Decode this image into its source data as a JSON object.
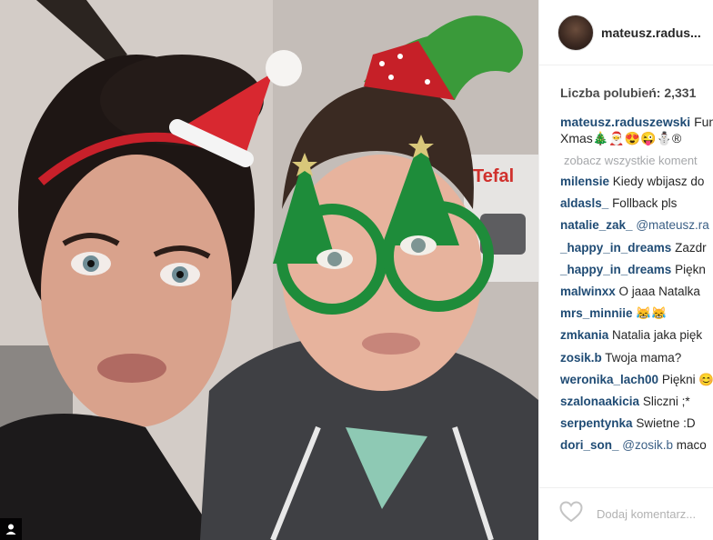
{
  "post": {
    "photo_alt": "Selfie of two people wearing Christmas accessories",
    "brand_sign": "Tefal"
  },
  "header": {
    "username": "mateusz.radus..."
  },
  "likes": {
    "text": "Liczba polubień: 2,331"
  },
  "caption": {
    "author": "mateusz.raduszewski",
    "text_line1": "Fun",
    "text_line2": "Xmas🎄🎅😍😜⛄®"
  },
  "comments": {
    "view_all": "zobacz wszystkie koment",
    "items": [
      {
        "author": "milensie",
        "text": "Kiedy wbijasz do"
      },
      {
        "author": "aldasls_",
        "text": "Follback pls"
      },
      {
        "author": "natalie_zak_",
        "mention": "@mateusz.ra"
      },
      {
        "author": "_happy_in_dreams",
        "text": "Zazdr"
      },
      {
        "author": "_happy_in_dreams",
        "text": "Piękn"
      },
      {
        "author": "malwinxx",
        "text": "O jaaa Natalka"
      },
      {
        "author": "mrs_minniie",
        "text": "😹😹"
      },
      {
        "author": "zmkania",
        "text": "Natalia jaka pięk"
      },
      {
        "author": "zosik.b",
        "text": "Twoja mama?"
      },
      {
        "author": "weronika_lach00",
        "text": "Piękni 😊"
      },
      {
        "author": "szalonaakicia",
        "text": "Sliczni ;*"
      },
      {
        "author": "serpentynka",
        "text": "Swietne :D"
      },
      {
        "author": "dori_son_",
        "mention": "@zosik.b",
        "text": "maco"
      }
    ]
  },
  "footer": {
    "add_comment_placeholder": "Dodaj komentarz..."
  },
  "colors": {
    "author": "#1f4b74",
    "mention": "#3b5f85",
    "muted": "#a5a7aa"
  }
}
